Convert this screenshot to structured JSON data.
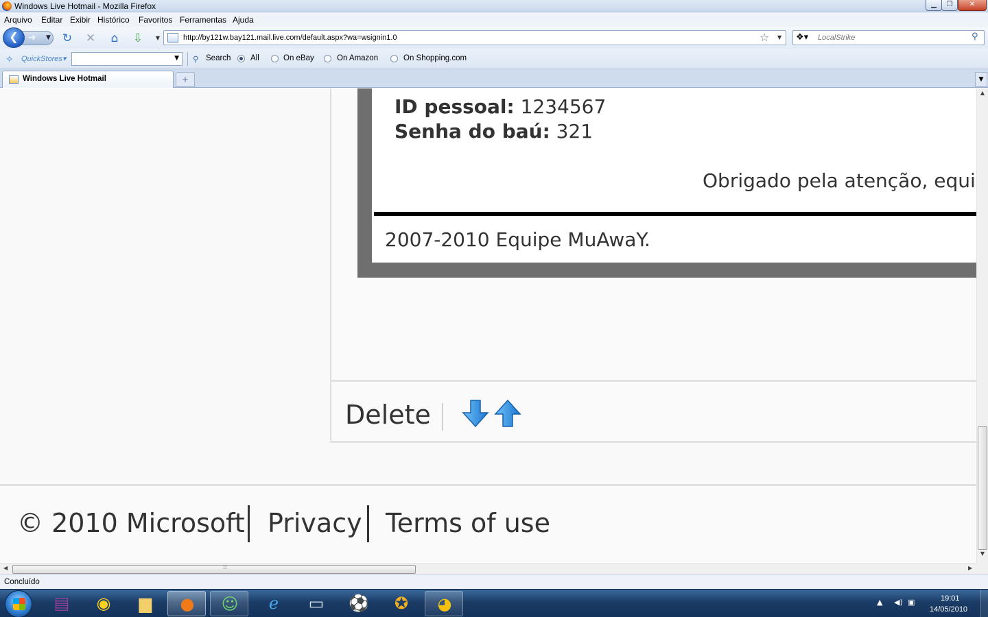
{
  "window": {
    "title": "Windows Live Hotmail - Mozilla Firefox"
  },
  "menu": [
    "Arquivo",
    "Editar",
    "Exibir",
    "Histórico",
    "Favoritos",
    "Ferramentas",
    "Ajuda"
  ],
  "nav": {
    "url": "http://by121w.bay121.mail.live.com/default.aspx?wa=wsignin1.0",
    "search_placeholder": "LocalStrike"
  },
  "quickstores": {
    "label": "QuickStores",
    "search_label": "Search",
    "options": [
      {
        "label": "All",
        "selected": true
      },
      {
        "label": "On eBay",
        "selected": false
      },
      {
        "label": "On Amazon",
        "selected": false
      },
      {
        "label": "On Shopping.com",
        "selected": false
      }
    ]
  },
  "tabs": [
    {
      "label": "Windows Live Hotmail",
      "active": true
    }
  ],
  "email": {
    "id_label": "ID pessoal:",
    "id_value": " 1234567",
    "password_label": "Senha do baú:",
    "password_value": " 321",
    "thanks": "Obrigado pela atenção, equipe",
    "copyright": "2007-2010 Equipe MuAwaY."
  },
  "actions": {
    "delete_label": "Delete"
  },
  "footer": {
    "copyright": "© 2010 Microsoft",
    "privacy": "Privacy",
    "terms": "Terms of use"
  },
  "status": {
    "text": "Concluído"
  },
  "taskbar": {
    "time": "19:01",
    "date": "14/05/2010",
    "apps": [
      "winrar-icon",
      "media-disc-icon",
      "folder-icon",
      "firefox-icon",
      "messenger-icon",
      "ie-icon",
      "monitor-icon",
      "soccer-game-icon",
      "game-icon",
      "chrome-icon"
    ]
  },
  "colors": {
    "email_frame": "#6f6f6f",
    "text": "#333333",
    "arrow_blue": "#2e8fdf",
    "taskbar": "#1b3c66"
  }
}
